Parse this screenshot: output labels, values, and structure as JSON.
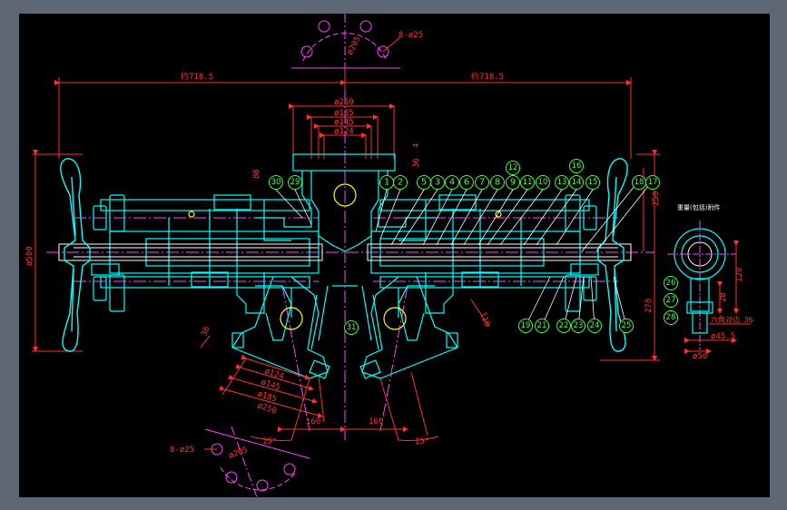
{
  "colors": {
    "background": "#000000",
    "frame": "#5d6874",
    "outline": "#00ffff",
    "dimension": "#ff3030",
    "centerline": "#ff40ff",
    "callout": "#40ff40",
    "hole": "#ffff00",
    "part": "#ffffff"
  },
  "dimensions": {
    "top_left_span": "约718.5",
    "top_right_span": "约718.5",
    "d250_top": "ø250",
    "d185_top": "ø185",
    "d145_top": "ø145",
    "d124_top": "ø124",
    "bolt_circle_top": "ø205",
    "bolts_top": "8-ø25",
    "bolts_bottom": "8-ø25",
    "bolt_circle_bottom": "ø205",
    "overall_height": "ø500",
    "height_right": "270",
    "height_right_small": "250",
    "flange_h": "36",
    "flange_h2": "4",
    "side_88": "88",
    "lower_36": "36",
    "d124_low": "ø124",
    "d145_low": "ø145",
    "d185_low": "ø185",
    "d250_low": "ø250",
    "base_left": "160",
    "base_right": "160",
    "angle_left": "15°",
    "angle_right": "15°",
    "len_110": "110",
    "detail_120": "120",
    "detail_small": "28",
    "detail_hex": "六角对边 36",
    "detail_d455": "ø45.5",
    "detail_d50": "ø50"
  },
  "detail_title": "重量(包括)附件",
  "callouts_top": [
    "30",
    "29",
    "1",
    "2",
    "5",
    "3",
    "4",
    "6",
    "7",
    "8",
    "9",
    "11",
    "12",
    "10",
    "13",
    "14",
    "16",
    "15",
    "18",
    "17"
  ],
  "callouts_bottom": [
    "19",
    "21",
    "22",
    "23",
    "24",
    "25",
    "31"
  ],
  "callouts_detail": [
    "26",
    "27",
    "28"
  ]
}
